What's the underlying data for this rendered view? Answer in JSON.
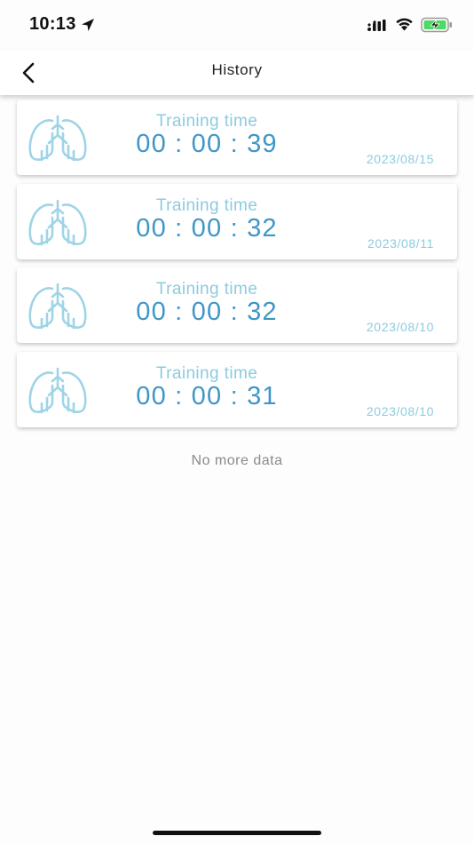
{
  "status_bar": {
    "time": "10:13",
    "icons": [
      "location-arrow-icon",
      "cellular-signal-icon",
      "wifi-icon",
      "battery-charging-icon"
    ],
    "battery_color": "#4cd964"
  },
  "nav": {
    "title": "History",
    "back_icon": "chevron-left-icon"
  },
  "records": [
    {
      "label": "Training time",
      "duration": "00 : 00 : 39",
      "date": "2023/08/15"
    },
    {
      "label": "Training time",
      "duration": "00 : 00 : 32",
      "date": "2023/08/11"
    },
    {
      "label": "Training time",
      "duration": "00 : 00 : 32",
      "date": "2023/08/10"
    },
    {
      "label": "Training time",
      "duration": "00 : 00 : 31",
      "date": "2023/08/10"
    }
  ],
  "list_footer": "No more data",
  "colors": {
    "accent_light": "#8ccbe0",
    "accent_dark": "#3e96c7",
    "icon": "#9fd4e6"
  }
}
